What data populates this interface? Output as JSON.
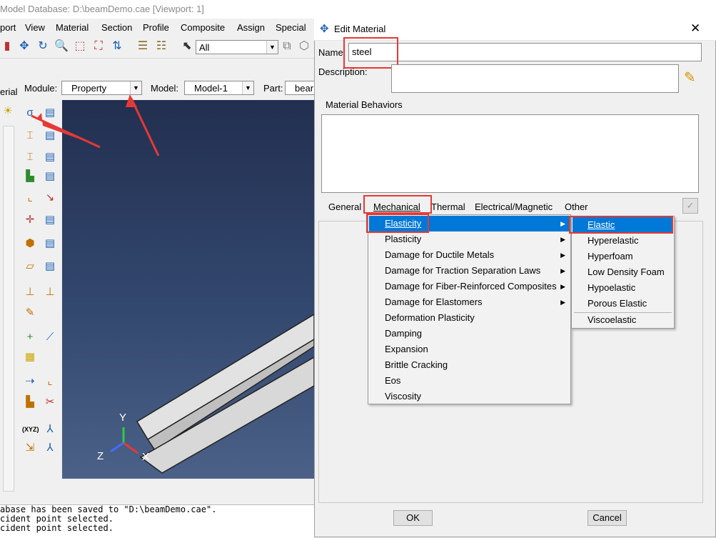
{
  "window": {
    "title": "Model Database: D:\\beamDemo.cae [Viewport: 1]"
  },
  "menubar": {
    "items": [
      "port",
      "View",
      "Material",
      "Section",
      "Profile",
      "Composite",
      "Assign",
      "Special"
    ]
  },
  "toolbar": {
    "filter_value": "All"
  },
  "modulebar": {
    "module_label": "Module:",
    "module_value": "Property",
    "model_label": "Model:",
    "model_value": "Model-1",
    "part_label": "Part:",
    "part_value": "bear"
  },
  "left_tab": {
    "label": "erial"
  },
  "viewport": {
    "axes": {
      "x": "X",
      "y": "Y",
      "z": "Z"
    },
    "colors": {
      "bg_top": "#222f50",
      "bg_bottom": "#4c6187",
      "beam": "#e0e0e0"
    }
  },
  "messages": [
    "abase has been saved to \"D:\\beamDemo.cae\".",
    "cident point selected.",
    "cident point selected."
  ],
  "dialog": {
    "title": "Edit Material",
    "close": "✕",
    "name_label": "Name:",
    "name_value": "steel",
    "description_label": "Description:",
    "behaviors_label": "Material Behaviors",
    "tabs": [
      "General",
      "Mechanical",
      "Thermal",
      "Electrical/Magnetic",
      "Other"
    ],
    "ok_label": "OK",
    "cancel_label": "Cancel"
  },
  "mechanical_menu": {
    "items": [
      {
        "label": "Elasticity",
        "submenu": true,
        "selected": true
      },
      {
        "label": "Plasticity",
        "submenu": true
      },
      {
        "label": "Damage for Ductile Metals",
        "submenu": true
      },
      {
        "label": "Damage for Traction Separation Laws",
        "submenu": true
      },
      {
        "label": "Damage for Fiber-Reinforced Composites",
        "submenu": true
      },
      {
        "label": "Damage for Elastomers",
        "submenu": true
      },
      {
        "label": "Deformation Plasticity",
        "submenu": false
      },
      {
        "label": "Damping",
        "submenu": false
      },
      {
        "label": "Expansion",
        "submenu": false
      },
      {
        "label": "Brittle Cracking",
        "submenu": false
      },
      {
        "label": "Eos",
        "submenu": false
      },
      {
        "label": "Viscosity",
        "submenu": false
      }
    ]
  },
  "elasticity_submenu": {
    "items": [
      "Elastic",
      "Hyperelastic",
      "Hyperfoam",
      "Low Density Foam",
      "Hypoelastic",
      "Porous Elastic",
      "Viscoelastic"
    ]
  },
  "colors": {
    "highlight": "#0078d7",
    "annotation_red": "#e53935"
  }
}
